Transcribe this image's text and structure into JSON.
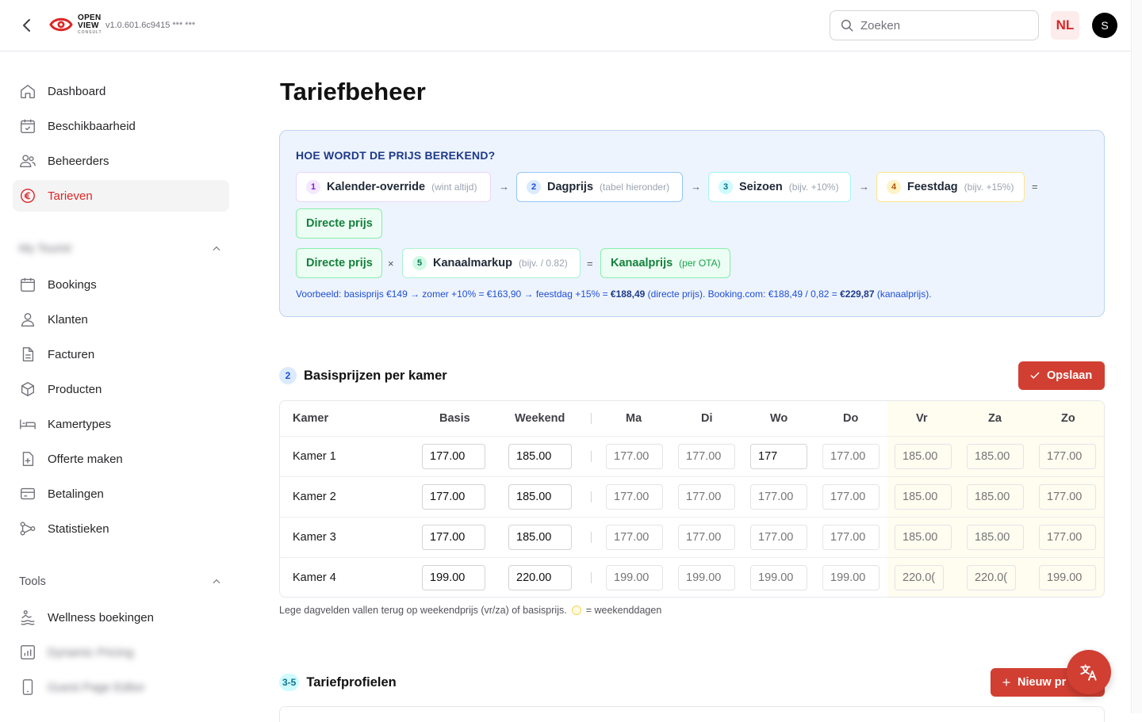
{
  "app": {
    "logo_line1": "OPEN",
    "logo_line2": "VIEW",
    "logo_sub": "CONSULT",
    "version": "v1.0.601.6c9415 *** ***"
  },
  "search": {
    "placeholder": "Zoeken"
  },
  "lang": "NL",
  "user_initial": "S",
  "sidebar": {
    "items": [
      {
        "label": "Dashboard"
      },
      {
        "label": "Beschikbaarheid"
      },
      {
        "label": "Beheerders"
      },
      {
        "label": "Tarieven"
      }
    ],
    "section_1": "My Tourist",
    "items_2": [
      {
        "label": "Bookings"
      },
      {
        "label": "Klanten"
      },
      {
        "label": "Facturen"
      },
      {
        "label": "Producten"
      },
      {
        "label": "Kamertypes"
      },
      {
        "label": "Offerte maken"
      },
      {
        "label": "Betalingen"
      },
      {
        "label": "Statistieken"
      }
    ],
    "section_2": "Tools",
    "items_3": [
      {
        "label": "Wellness boekingen"
      },
      {
        "label": "Dynamic Pricing"
      },
      {
        "label": "Guest Page Editor"
      }
    ]
  },
  "page": {
    "title": "Tariefbeheer"
  },
  "info": {
    "title": "HOE WORDT DE PRIJS BEREKEND?",
    "steps": [
      {
        "num": "1",
        "label": "Kalender-override",
        "hint": "(wint altijd)"
      },
      {
        "num": "2",
        "label": "Dagprijs",
        "hint": "(tabel hieronder)"
      },
      {
        "num": "3",
        "label": "Seizoen",
        "hint": "(bijv. +10%)"
      },
      {
        "num": "4",
        "label": "Feestdag",
        "hint": "(bijv. +15%)"
      },
      {
        "num": "5",
        "label": "Kanaalmarkup",
        "hint": "(bijv. / 0.82)"
      }
    ],
    "arrow": "→",
    "equals": "=",
    "times": "×",
    "direct": "Directe prijs",
    "channel": "Kanaalprijs",
    "channel_hint": "(per OTA)",
    "example_a": "Voorbeeld: basisprijs €149 → zomer +10% = €163,90 → feestdag +15% = ",
    "example_b": "€188,49",
    "example_c": " (directe prijs). Booking.com: €188,49 / 0,82 = ",
    "example_d": "€229,87",
    "example_e": " (kanaalprijs)."
  },
  "base": {
    "num": "2",
    "title": "Basisprijzen per kamer",
    "save": "Opslaan",
    "headers": [
      "Kamer",
      "Basis",
      "Weekend",
      "Ma",
      "Di",
      "Wo",
      "Do",
      "Vr",
      "Za",
      "Zo"
    ],
    "rows": [
      {
        "name": "Kamer 1",
        "basis": "177.00",
        "weekend": "185.00",
        "days": [
          "177.00",
          "177.00",
          "177",
          "177.00",
          "185.00",
          "185.00",
          "177.00"
        ]
      },
      {
        "name": "Kamer 2",
        "basis": "177.00",
        "weekend": "185.00",
        "days": [
          "177.00",
          "177.00",
          "177.00",
          "177.00",
          "185.00",
          "185.00",
          "177.00"
        ]
      },
      {
        "name": "Kamer 3",
        "basis": "177.00",
        "weekend": "185.00",
        "days": [
          "177.00",
          "177.00",
          "177.00",
          "177.00",
          "185.00",
          "185.00",
          "177.00"
        ]
      },
      {
        "name": "Kamer 4",
        "basis": "199.00",
        "weekend": "220.00",
        "days": [
          "199.00",
          "199.00",
          "199.00",
          "199.00",
          "220.0(",
          "220.0(",
          "199.00"
        ]
      }
    ],
    "note": "Lege dagvelden vallen terug op weekendprijs (vr/za) of basisprijs.",
    "legend": "= weekenddagen"
  },
  "profiles": {
    "num": "3-5",
    "title": "Tariefprofielen",
    "new": "Nieuw pr"
  }
}
